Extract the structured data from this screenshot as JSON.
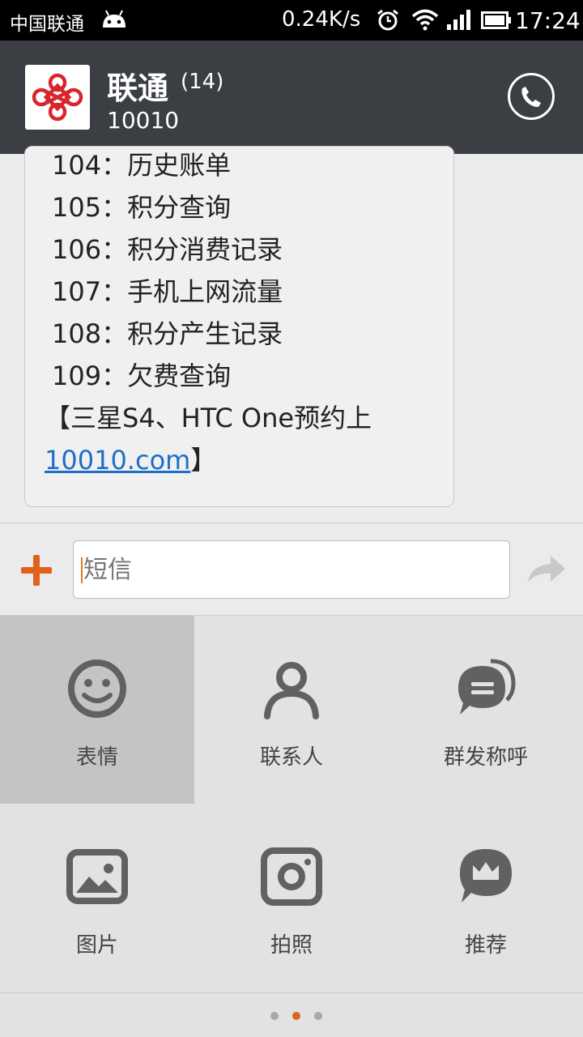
{
  "status_bar": {
    "carrier": "中国联通",
    "speed": "0.24K/s",
    "time": "17:24"
  },
  "header": {
    "contact_name": "联通",
    "count": "(14)",
    "number": "10010"
  },
  "message": {
    "lines": [
      "104：历史账单",
      "105：积分查询",
      "106：积分消费记录",
      "107：手机上网流量",
      "108：积分产生记录",
      "109：欠费查询",
      "【三星S4、HTC One预约上"
    ],
    "link": "10010.com",
    "link_suffix": "】"
  },
  "compose": {
    "placeholder": "短信"
  },
  "attachments": {
    "items": [
      {
        "label": "表情",
        "icon": "smiley-icon"
      },
      {
        "label": "联系人",
        "icon": "person-icon"
      },
      {
        "label": "群发称呼",
        "icon": "chat-bubbles-icon"
      },
      {
        "label": "图片",
        "icon": "image-icon"
      },
      {
        "label": "拍照",
        "icon": "camera-icon"
      },
      {
        "label": "推荐",
        "icon": "crown-bubble-icon"
      }
    ],
    "page_indicator": {
      "pages": 3,
      "active": 2
    }
  },
  "colors": {
    "header_bg": "#3b3f44",
    "accent": "#e0621b",
    "link": "#1e6fc8",
    "icon_gray": "#5f6163"
  }
}
